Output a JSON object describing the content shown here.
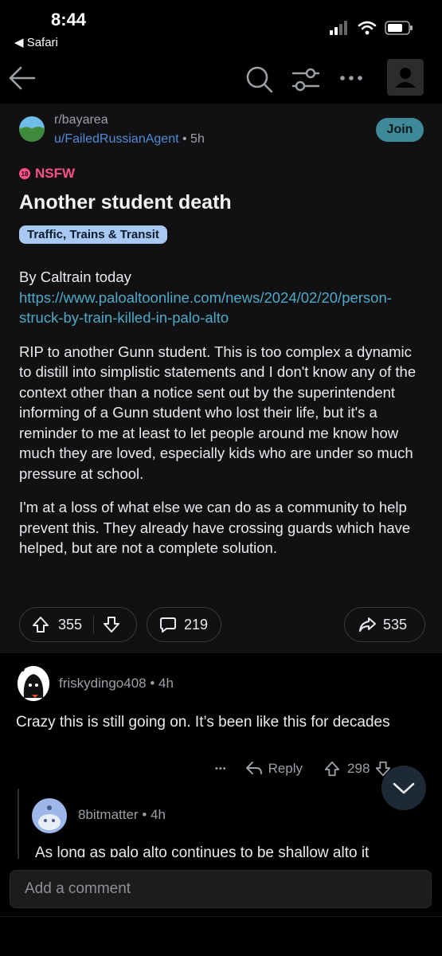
{
  "status_bar": {
    "time": "8:44",
    "back_app": "◀ Safari"
  },
  "post": {
    "subreddit": "r/bayarea",
    "author": "u/FailedRussianAgent",
    "age": " • 5h",
    "join_label": "Join",
    "nsfw_label": "NSFW",
    "nsfw_badge": "18",
    "title": "Another student death",
    "flair": "Traffic, Trains & Transit",
    "body": {
      "p1_text": "By Caltrain today ",
      "p1_link": "https://www.paloaltoonline.com/news/2024/02/20/person-struck-by-train-killed-in-palo-alto",
      "p2": "RIP to another Gunn student. This is too complex a dynamic to distill into simplistic statements and I don't know any of the context other than a notice sent out by the superintendent informing of a Gunn student who lost their life, but it's a reminder to me at least to let people around me know how much they are loved, especially kids who are under so much pressure at school.",
      "p3": "I'm at a loss of what else we can do as a community to help prevent this. They already have crossing guards which have helped, but are not a complete solution."
    },
    "votes": "355",
    "comments": "219",
    "shares": "535"
  },
  "comment": {
    "user": "friskydingo408",
    "age": " • 4h",
    "body": "Crazy this is still going on. It’s been like this for decades",
    "more": "•••",
    "reply_label": "Reply",
    "score": "298"
  },
  "reply": {
    "user": "8bitmatter",
    "age": " • 4h",
    "body": "As long as palo alto continues to be shallow alto it"
  },
  "composer": {
    "placeholder": "Add a comment"
  },
  "colors": {
    "accent": "#3f8a99",
    "link": "#4ea9c7",
    "nsfw": "#ff4f8b",
    "flair": "#a9c9f2"
  }
}
